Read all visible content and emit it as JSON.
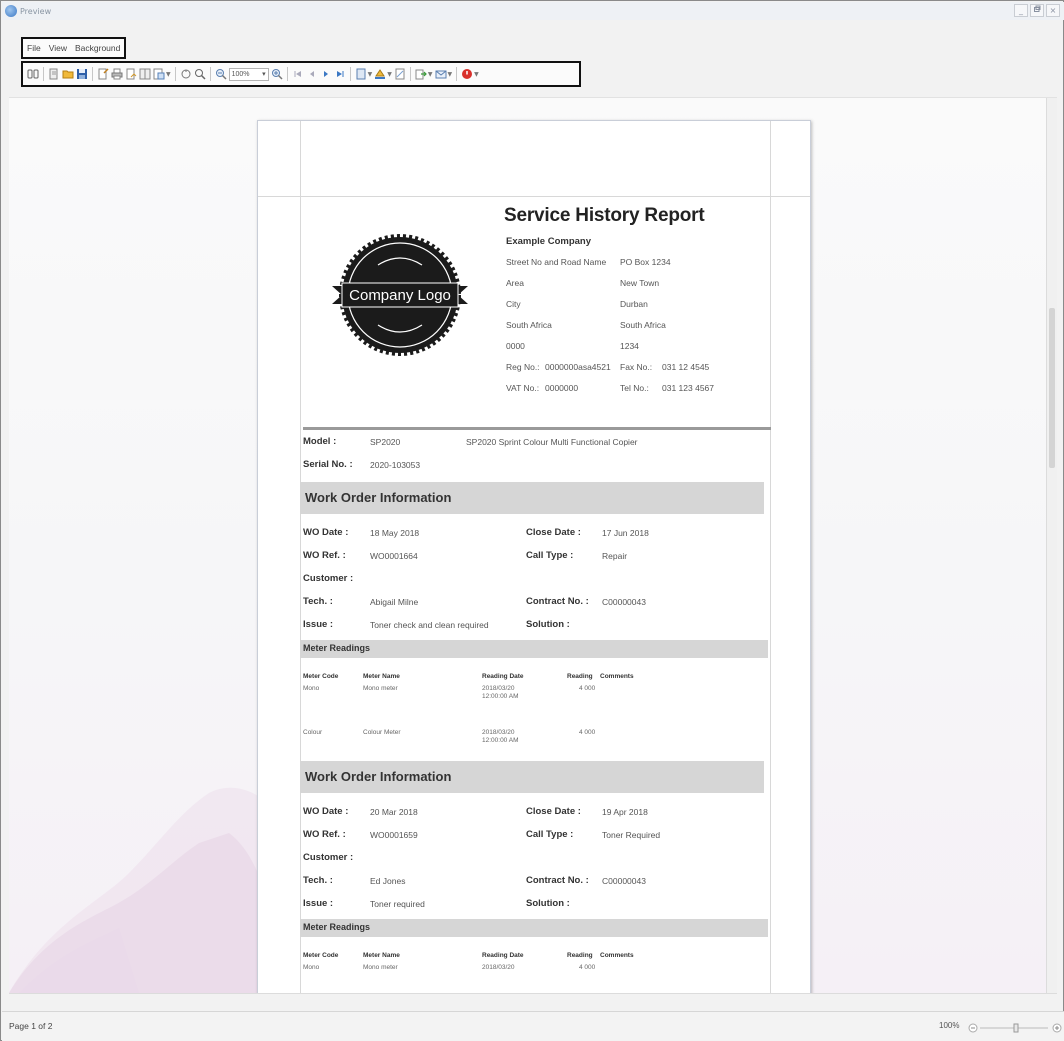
{
  "window": {
    "title": "Preview",
    "controls": [
      "_",
      "×"
    ]
  },
  "menu": {
    "items": [
      "File",
      "View",
      "Background"
    ]
  },
  "toolbar": {
    "zoom_value": "100%"
  },
  "report": {
    "title": "Service History Report",
    "company": {
      "name": "Example Company",
      "logo_text": "Company Logo",
      "left_col": [
        "Street No and Road Name",
        "Area",
        "City",
        "South Africa",
        "0000"
      ],
      "right_col": [
        "PO Box 1234",
        "New Town",
        "Durban",
        "South Africa",
        "1234"
      ],
      "reg_label": "Reg No.:",
      "reg_value": "0000000asa4521",
      "fax_label": "Fax No.:",
      "fax_value": "031 12 4545",
      "vat_label": "VAT No.:",
      "vat_value": "0000000",
      "tel_label": "Tel No.:",
      "tel_value": "031 123 4567"
    },
    "model_label": "Model :",
    "model_value": "SP2020",
    "model_desc": "SP2020 Sprint Colour Multi Functional Copier",
    "serial_label": "Serial No. :",
    "serial_value": "2020-103053",
    "labels": {
      "section": "Work Order Information",
      "wo_date": "WO Date :",
      "wo_ref": "WO Ref. :",
      "customer": "Customer :",
      "tech": "Tech. :",
      "issue": "Issue :",
      "close_date": "Close Date :",
      "call_type": "Call Type :",
      "contract": "Contract No. :",
      "solution": "Solution :",
      "meter_readings": "Meter Readings",
      "meter_code": "Meter Code",
      "meter_name": "Meter Name",
      "reading_date": "Reading Date",
      "reading": "Reading",
      "comments": "Comments"
    },
    "work_orders": [
      {
        "wo_date": "18 May 2018",
        "wo_ref": "WO0001664",
        "customer": "",
        "tech": "Abigail Milne",
        "issue": "Toner check and clean required",
        "close_date": "17 Jun 2018",
        "call_type": "Repair",
        "contract": "C00000043",
        "solution": "",
        "meters": [
          {
            "code": "Mono",
            "name": "Mono meter",
            "date": "2018/03/20",
            "time": "12:00:00 AM",
            "reading": "4 000",
            "comments": ""
          },
          {
            "code": "Colour",
            "name": "Colour Meter",
            "date": "2018/03/20",
            "time": "12:00:00 AM",
            "reading": "4 000",
            "comments": ""
          }
        ]
      },
      {
        "wo_date": "20 Mar 2018",
        "wo_ref": "WO0001659",
        "customer": "",
        "tech": "Ed Jones",
        "issue": "Toner required",
        "close_date": "19 Apr 2018",
        "call_type": "Toner Required",
        "contract": "C00000043",
        "solution": "",
        "meters": [
          {
            "code": "Mono",
            "name": "Mono meter",
            "date": "2018/03/20",
            "time": "",
            "reading": "4 000",
            "comments": ""
          }
        ]
      }
    ]
  },
  "status": {
    "page": "Page 1 of 2",
    "zoom": "100%"
  }
}
